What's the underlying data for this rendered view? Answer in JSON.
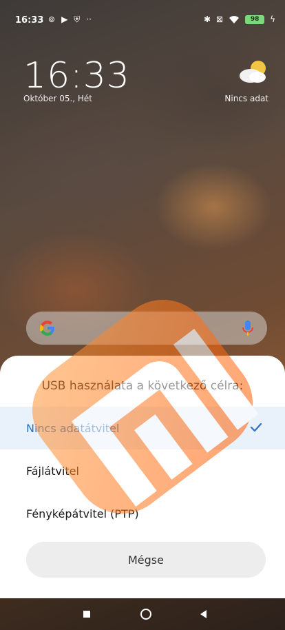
{
  "status_bar": {
    "time": "16:33",
    "battery": "98"
  },
  "lockscreen": {
    "clock": "16:33",
    "date": "Október 05., Hét",
    "weather_text": "Nincs adat",
    "weather_icon": "cloud-sun-icon"
  },
  "search_bar": {
    "logo": "google-g-icon",
    "mic": "microphone-icon"
  },
  "usb_dialog": {
    "title": "USB használata a következő célra:",
    "options": [
      {
        "label": "Nincs adatátvitel",
        "selected": true
      },
      {
        "label": "Fájlátvitel",
        "selected": false
      },
      {
        "label": "Fényképátvitel (PTP)",
        "selected": false
      }
    ],
    "cancel_label": "Mégse"
  },
  "nav_bar": {
    "recents": "square-icon",
    "home": "circle-icon",
    "back": "triangle-back-icon"
  },
  "colors": {
    "accent": "#2d6fc1",
    "selected_bg": "#e9f1fb",
    "mi_orange": "#ff6900"
  }
}
